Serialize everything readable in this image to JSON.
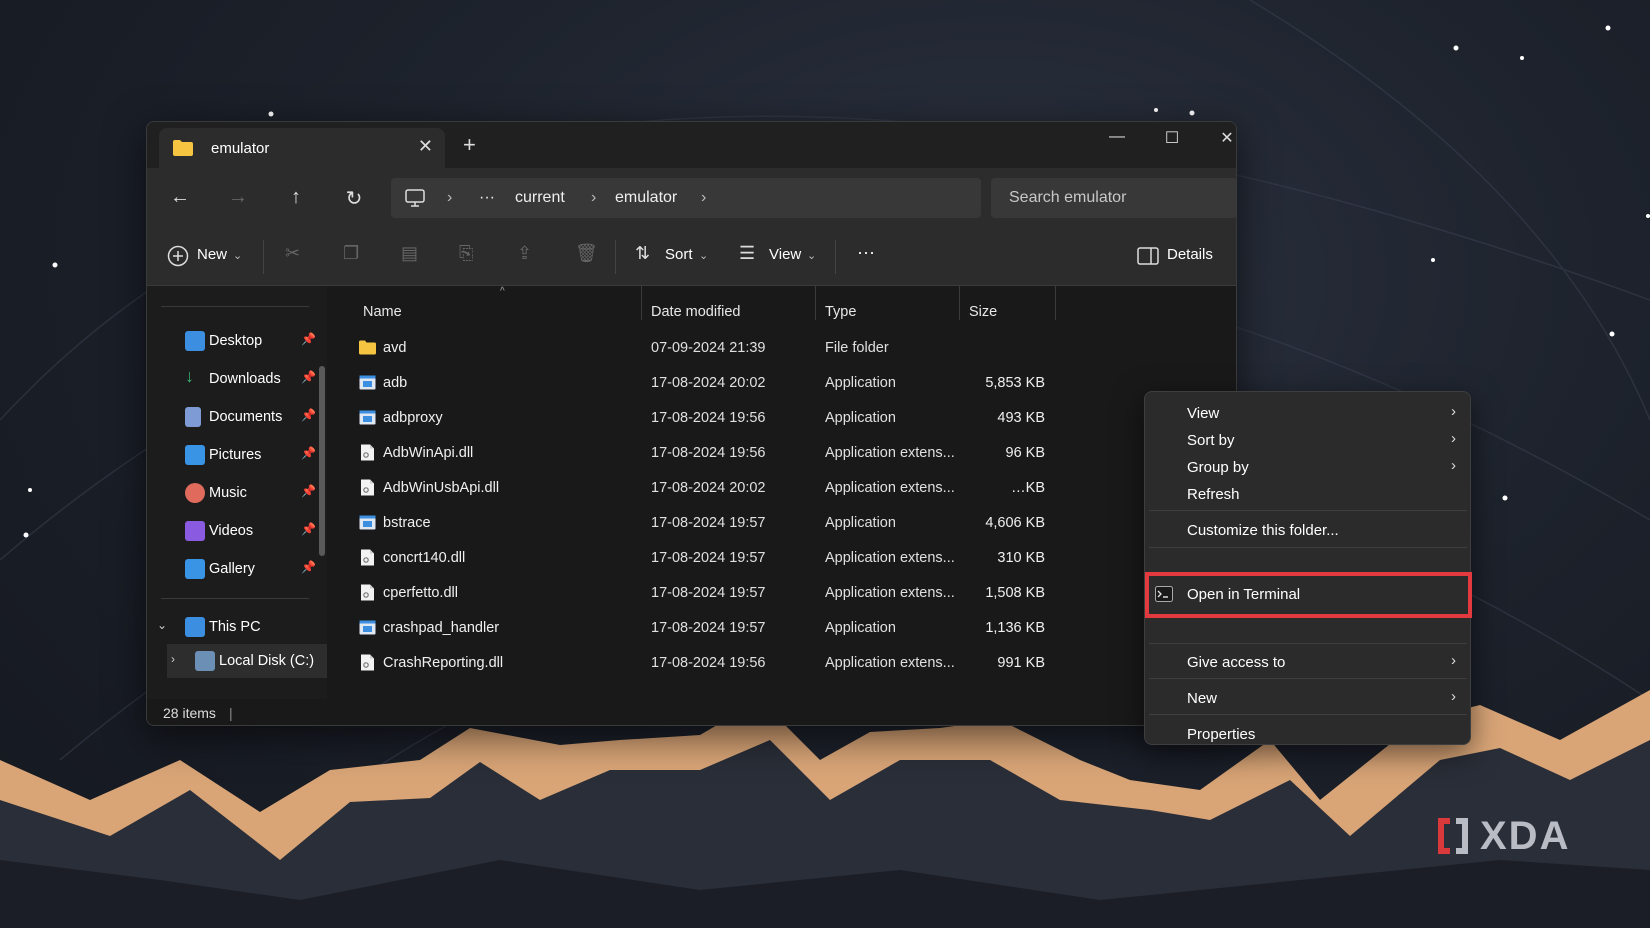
{
  "window": {
    "tab_title": "emulator",
    "tab_close": "✕",
    "new_tab": "+",
    "minimize": "—",
    "maximize": "☐",
    "close": "✕"
  },
  "nav": {
    "back": "←",
    "forward": "→",
    "up": "↑",
    "refresh": "↻",
    "breadcrumb": [
      "current",
      "emulator"
    ],
    "more": "···",
    "search_placeholder": "Search emulator"
  },
  "toolbar": {
    "new_label": "New",
    "sort_label": "Sort",
    "view_label": "View",
    "more": "···",
    "details_label": "Details"
  },
  "sidebar": {
    "items": [
      {
        "label": "Desktop",
        "color": "#3b8ee0"
      },
      {
        "label": "Downloads",
        "color": "#37b36d"
      },
      {
        "label": "Documents",
        "color": "#7f9bd6"
      },
      {
        "label": "Pictures",
        "color": "#3a94e6"
      },
      {
        "label": "Music",
        "color": "#e06a5b"
      },
      {
        "label": "Videos",
        "color": "#8a5be0"
      },
      {
        "label": "Gallery",
        "color": "#3a94e6"
      }
    ],
    "this_pc": "This PC",
    "local_disk": "Local Disk (C:)"
  },
  "columns": {
    "name": "Name",
    "date": "Date modified",
    "type": "Type",
    "size": "Size"
  },
  "files": [
    {
      "name": "avd",
      "date": "07-09-2024 21:39",
      "type": "File folder",
      "size": "",
      "icon": "folder-icon"
    },
    {
      "name": "adb",
      "date": "17-08-2024 20:02",
      "type": "Application",
      "size": "5,853 KB",
      "icon": "app-icon"
    },
    {
      "name": "adbproxy",
      "date": "17-08-2024 19:56",
      "type": "Application",
      "size": "493 KB",
      "icon": "app-icon"
    },
    {
      "name": "AdbWinApi.dll",
      "date": "17-08-2024 19:56",
      "type": "Application extens...",
      "size": "96 KB",
      "icon": "dll-icon"
    },
    {
      "name": "AdbWinUsbApi.dll",
      "date": "17-08-2024 20:02",
      "type": "Application extens...",
      "size": "…KB",
      "icon": "dll-icon"
    },
    {
      "name": "bstrace",
      "date": "17-08-2024 19:57",
      "type": "Application",
      "size": "4,606 KB",
      "icon": "app-icon"
    },
    {
      "name": "concrt140.dll",
      "date": "17-08-2024 19:57",
      "type": "Application extens...",
      "size": "310 KB",
      "icon": "dll-icon"
    },
    {
      "name": "cperfetto.dll",
      "date": "17-08-2024 19:57",
      "type": "Application extens...",
      "size": "1,508 KB",
      "icon": "dll-icon"
    },
    {
      "name": "crashpad_handler",
      "date": "17-08-2024 19:57",
      "type": "Application",
      "size": "1,136 KB",
      "icon": "app-icon"
    },
    {
      "name": "CrashReporting.dll",
      "date": "17-08-2024 19:56",
      "type": "Application extens...",
      "size": "991 KB",
      "icon": "dll-icon"
    }
  ],
  "status": {
    "items": "28 items"
  },
  "context_menu": {
    "view": "View",
    "sort_by": "Sort by",
    "group_by": "Group by",
    "refresh": "Refresh",
    "customize": "Customize this folder...",
    "open_terminal": "Open in Terminal",
    "give_access": "Give access to",
    "new": "New",
    "properties": "Properties",
    "chevron": "›"
  },
  "colors": {
    "highlight": "#e23a3e",
    "arrow": "#e23a3e",
    "window_bg": "#191919",
    "menu_bg": "#2b2b2b"
  },
  "logo_text": "XDA"
}
